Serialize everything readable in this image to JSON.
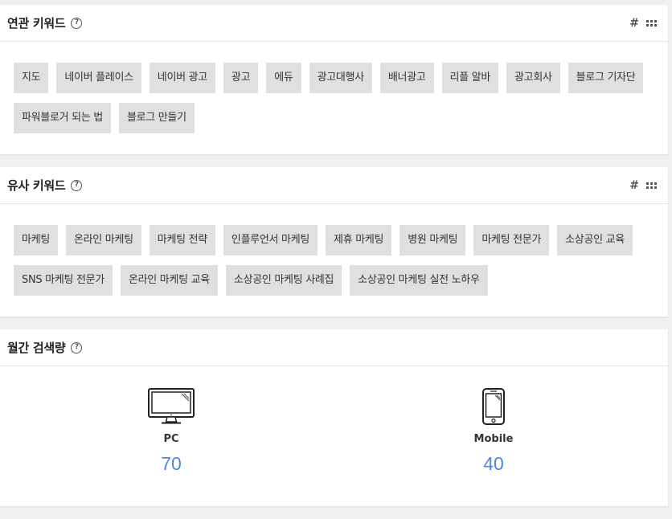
{
  "related": {
    "title": "연관 키워드",
    "tags": [
      "지도",
      "네이버 플레이스",
      "네이버 광고",
      "광고",
      "에듀",
      "광고대행사",
      "배너광고",
      "리플 알바",
      "광고회사",
      "블로그 기자단",
      "파워블로거 되는 법",
      "블로그 만들기"
    ]
  },
  "similar": {
    "title": "유사 키워드",
    "tags": [
      "마케팅",
      "온라인 마케팅",
      "마케팅 전략",
      "인플루언서 마케팅",
      "제휴 마케팅",
      "병원 마케팅",
      "마케팅 전문가",
      "소상공인 교육",
      "SNS 마케팅 전문가",
      "온라인 마케팅 교육",
      "소상공인 마케팅 사례집",
      "소상공인 마케팅 실전 노하우"
    ]
  },
  "volume": {
    "title": "월간 검색량",
    "pc_label": "PC",
    "pc_value": "70",
    "mobile_label": "Mobile",
    "mobile_value": "40"
  },
  "icons": {
    "help": "help-icon",
    "hash": "hash-icon",
    "grid": "grid-view-icon",
    "pc": "monitor-icon",
    "mobile": "smartphone-icon"
  },
  "colors": {
    "value_accent": "#4f86de",
    "tag_bg": "#e0e0e2"
  }
}
